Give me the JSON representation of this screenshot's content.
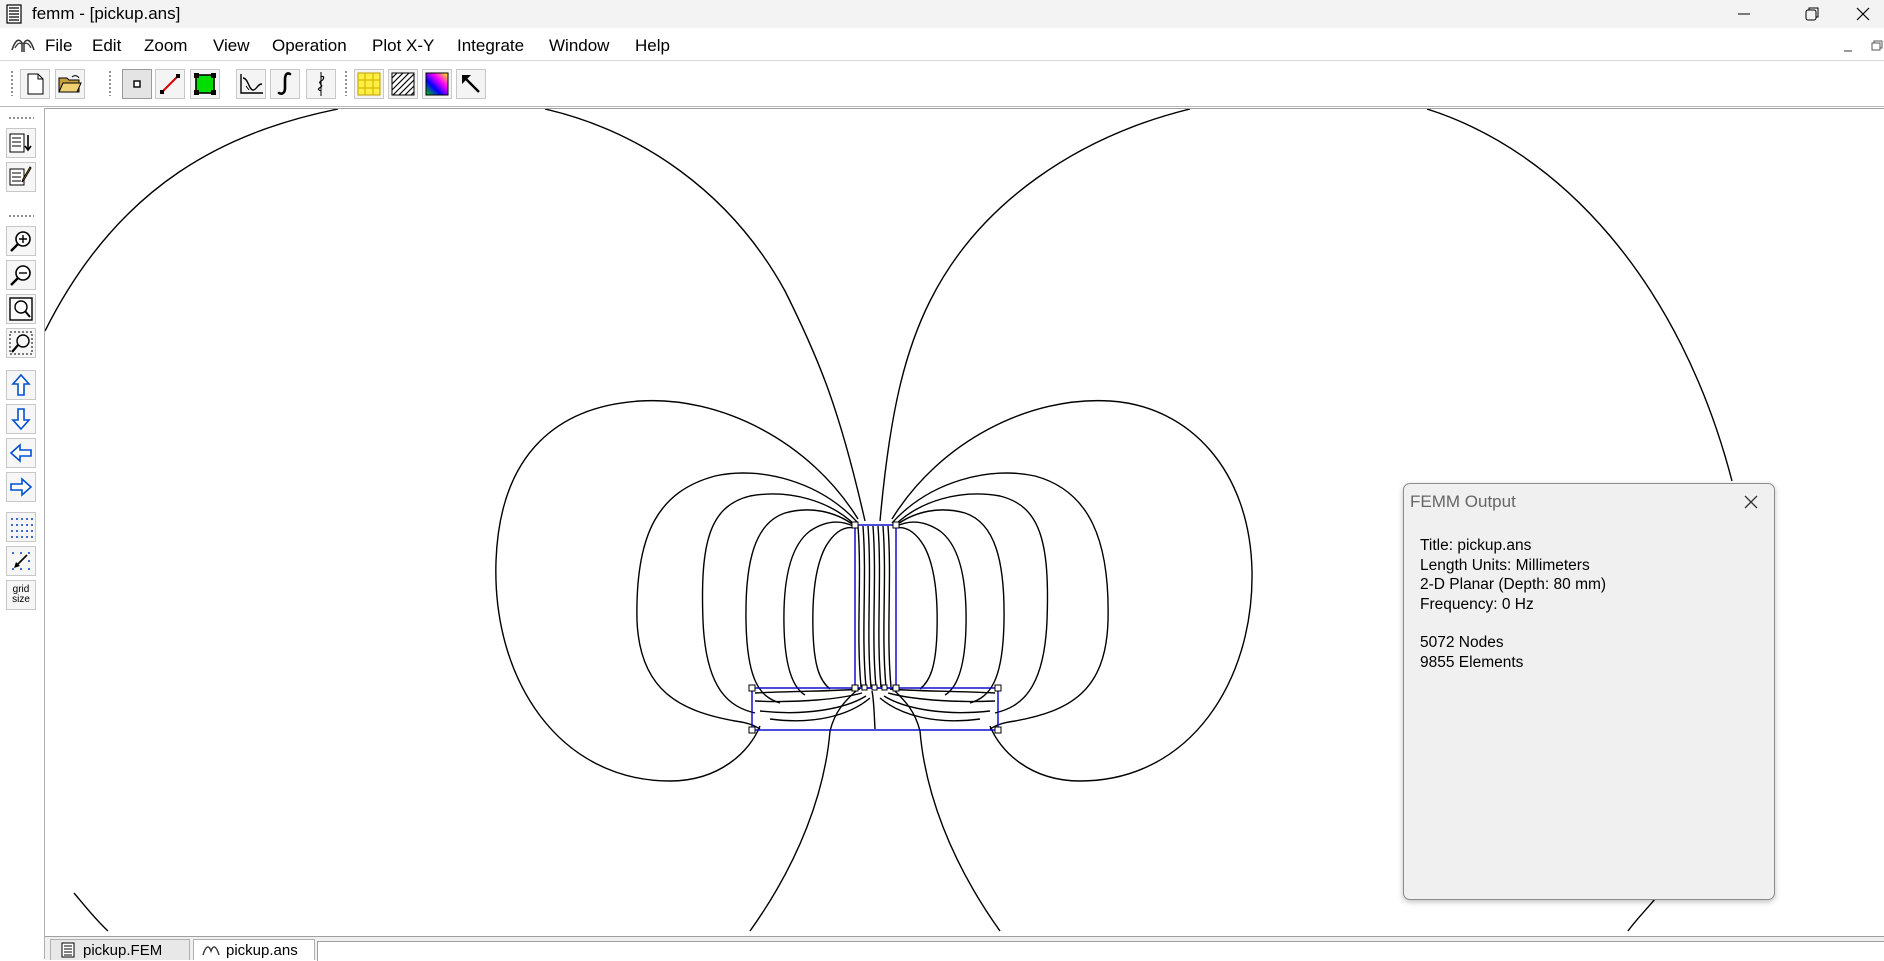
{
  "window": {
    "title": "femm - [pickup.ans]"
  },
  "menu": {
    "items": [
      "File",
      "Edit",
      "Zoom",
      "View",
      "Operation",
      "Plot X-Y",
      "Integrate",
      "Window",
      "Help"
    ]
  },
  "toolbar": {
    "buttons": [
      "new-file",
      "open-file",
      "node-mode",
      "segment-mode",
      "block-mode",
      "plot-xy",
      "integrate",
      "line-integral",
      "contour-plot",
      "density-plot",
      "vector-plot",
      "select"
    ]
  },
  "left_toolbar": {
    "grid_size_label": [
      "grid",
      "size"
    ]
  },
  "output": {
    "title": "FEMM Output",
    "title_line": "Title: pickup.ans",
    "length_units": "Length Units: Millimeters",
    "planar": "2-D Planar (Depth: 80 mm)",
    "frequency": "Frequency: 0 Hz",
    "nodes": "5072 Nodes",
    "elements": "9855 Elements"
  },
  "tabs": [
    {
      "label": "pickup.FEM",
      "active": false
    },
    {
      "label": "pickup.ans",
      "active": true
    }
  ],
  "colors": {
    "geometry": "#0000cc",
    "contours": "#000000",
    "block_label": "#00dd00"
  }
}
